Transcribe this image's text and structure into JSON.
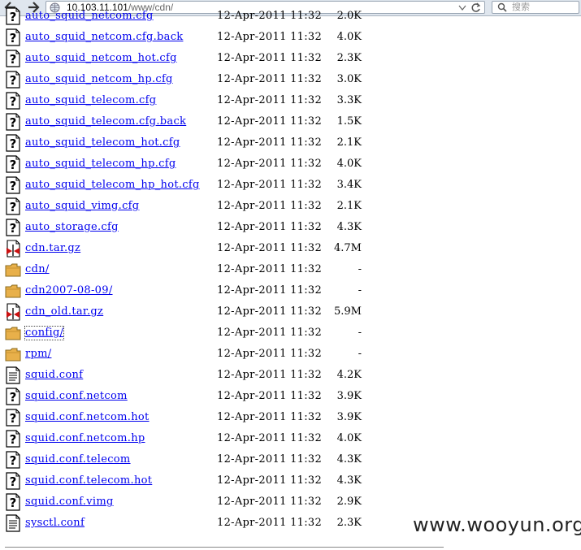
{
  "toolbar": {
    "url_host": "10.103.11.101",
    "url_path": "/www/cdn/",
    "search_placeholder": "搜索"
  },
  "listing": {
    "rows": [
      {
        "name": "auto_squid_netcom.cfg",
        "date": "12-Apr-2011 11:32",
        "size": "2.0K",
        "icon": "unknown-file-icon"
      },
      {
        "name": "auto_squid_netcom.cfg.back",
        "date": "12-Apr-2011 11:32",
        "size": "4.0K",
        "icon": "unknown-file-icon"
      },
      {
        "name": "auto_squid_netcom_hot.cfg",
        "date": "12-Apr-2011 11:32",
        "size": "2.3K",
        "icon": "unknown-file-icon"
      },
      {
        "name": "auto_squid_netcom_hp.cfg",
        "date": "12-Apr-2011 11:32",
        "size": "3.0K",
        "icon": "unknown-file-icon"
      },
      {
        "name": "auto_squid_telecom.cfg",
        "date": "12-Apr-2011 11:32",
        "size": "3.3K",
        "icon": "unknown-file-icon"
      },
      {
        "name": "auto_squid_telecom.cfg.back",
        "date": "12-Apr-2011 11:32",
        "size": "1.5K",
        "icon": "unknown-file-icon"
      },
      {
        "name": "auto_squid_telecom_hot.cfg",
        "date": "12-Apr-2011 11:32",
        "size": "2.1K",
        "icon": "unknown-file-icon"
      },
      {
        "name": "auto_squid_telecom_hp.cfg",
        "date": "12-Apr-2011 11:32",
        "size": "4.0K",
        "icon": "unknown-file-icon"
      },
      {
        "name": "auto_squid_telecom_hp_hot.cfg",
        "date": "12-Apr-2011 11:32",
        "size": "3.4K",
        "icon": "unknown-file-icon"
      },
      {
        "name": "auto_squid_vimg.cfg",
        "date": "12-Apr-2011 11:32",
        "size": "2.1K",
        "icon": "unknown-file-icon"
      },
      {
        "name": "auto_storage.cfg",
        "date": "12-Apr-2011 11:32",
        "size": "4.3K",
        "icon": "unknown-file-icon"
      },
      {
        "name": "cdn.tar.gz",
        "date": "12-Apr-2011 11:32",
        "size": "4.7M",
        "icon": "archive-icon"
      },
      {
        "name": "cdn/",
        "date": "12-Apr-2011 11:32",
        "size": "-",
        "icon": "folder-icon"
      },
      {
        "name": "cdn2007-08-09/",
        "date": "12-Apr-2011 11:32",
        "size": "-",
        "icon": "folder-icon"
      },
      {
        "name": "cdn_old.tar.gz",
        "date": "12-Apr-2011 11:32",
        "size": "5.9M",
        "icon": "archive-icon"
      },
      {
        "name": "config/",
        "date": "12-Apr-2011 11:32",
        "size": "-",
        "icon": "folder-icon",
        "focused": true
      },
      {
        "name": "rpm/",
        "date": "12-Apr-2011 11:32",
        "size": "-",
        "icon": "folder-icon"
      },
      {
        "name": "squid.conf",
        "date": "12-Apr-2011 11:32",
        "size": "4.2K",
        "icon": "text-file-icon"
      },
      {
        "name": "squid.conf.netcom",
        "date": "12-Apr-2011 11:32",
        "size": "3.9K",
        "icon": "unknown-file-icon"
      },
      {
        "name": "squid.conf.netcom.hot",
        "date": "12-Apr-2011 11:32",
        "size": "3.9K",
        "icon": "unknown-file-icon"
      },
      {
        "name": "squid.conf.netcom.hp",
        "date": "12-Apr-2011 11:32",
        "size": "4.0K",
        "icon": "unknown-file-icon"
      },
      {
        "name": "squid.conf.telecom",
        "date": "12-Apr-2011 11:32",
        "size": "4.3K",
        "icon": "unknown-file-icon"
      },
      {
        "name": "squid.conf.telecom.hot",
        "date": "12-Apr-2011 11:32",
        "size": "4.3K",
        "icon": "unknown-file-icon"
      },
      {
        "name": "squid.conf.vimg",
        "date": "12-Apr-2011 11:32",
        "size": "2.9K",
        "icon": "unknown-file-icon"
      },
      {
        "name": "sysctl.conf",
        "date": "12-Apr-2011 11:32",
        "size": "2.3K",
        "icon": "text-file-icon"
      }
    ]
  },
  "watermark": "www.wooyun.org",
  "colors": {
    "link": "#0000ee",
    "toolbar_bg": "#dfe6ee",
    "folder": "#e8b04a",
    "archive_red": "#cc1111"
  }
}
